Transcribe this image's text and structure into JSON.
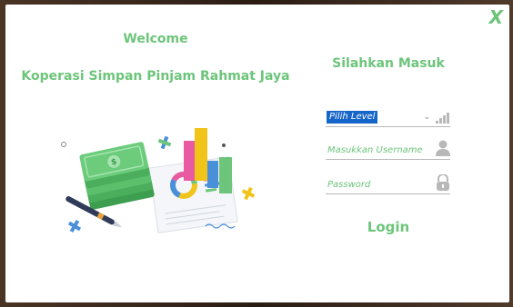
{
  "window": {
    "close_label": "X"
  },
  "left": {
    "welcome": "Welcome",
    "company": "Koperasi Simpan Pinjam Rahmat Jaya"
  },
  "form": {
    "title": "Silahkan Masuk",
    "level_value": "Pilih Level",
    "username_placeholder": "Masukkan Username",
    "password_placeholder": "Password",
    "login_label": "Login"
  },
  "colors": {
    "accent": "#6cc57a",
    "selection": "#1665c8"
  },
  "icons": [
    "signal-bars-icon",
    "user-icon",
    "lock-icon",
    "chevron-down-icon",
    "close-icon"
  ]
}
